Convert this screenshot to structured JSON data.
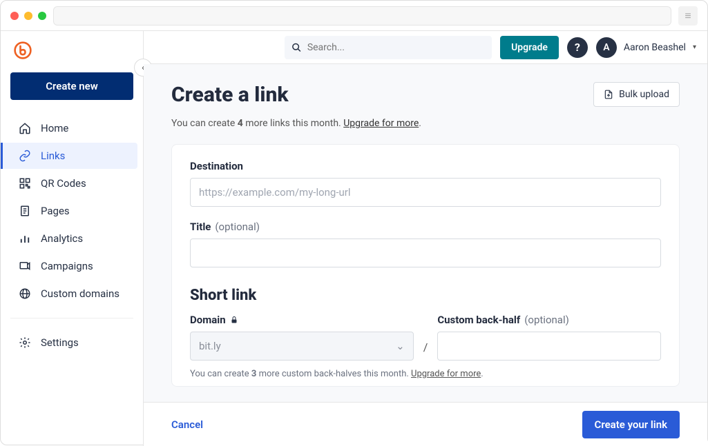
{
  "sidebar": {
    "create_label": "Create new",
    "items": [
      {
        "label": "Home"
      },
      {
        "label": "Links"
      },
      {
        "label": "QR Codes"
      },
      {
        "label": "Pages"
      },
      {
        "label": "Analytics"
      },
      {
        "label": "Campaigns"
      },
      {
        "label": "Custom domains"
      }
    ],
    "settings_label": "Settings"
  },
  "topbar": {
    "search_placeholder": "Search...",
    "upgrade_label": "Upgrade",
    "help_label": "?",
    "user_initial": "A",
    "user_name": "Aaron Beashel"
  },
  "page": {
    "title": "Create a link",
    "bulk_upload_label": "Bulk upload",
    "quota_prefix": "You can create ",
    "quota_count": "4",
    "quota_suffix": " more links this month. ",
    "quota_link": "Upgrade for more",
    "quota_period": "."
  },
  "form": {
    "destination_label": "Destination",
    "destination_placeholder": "https://example.com/my-long-url",
    "title_label": "Title",
    "optional": "(optional)",
    "shortlink_heading": "Short link",
    "domain_label": "Domain",
    "domain_value": "bit.ly",
    "backhalf_label": "Custom back-half",
    "slash": "/",
    "backhalf_quota_prefix": "You can create ",
    "backhalf_quota_count": "3",
    "backhalf_quota_suffix": " more custom back-halves this month.  ",
    "backhalf_quota_link": "Upgrade for more",
    "backhalf_quota_period": "."
  },
  "footer": {
    "cancel_label": "Cancel",
    "submit_label": "Create your link"
  }
}
